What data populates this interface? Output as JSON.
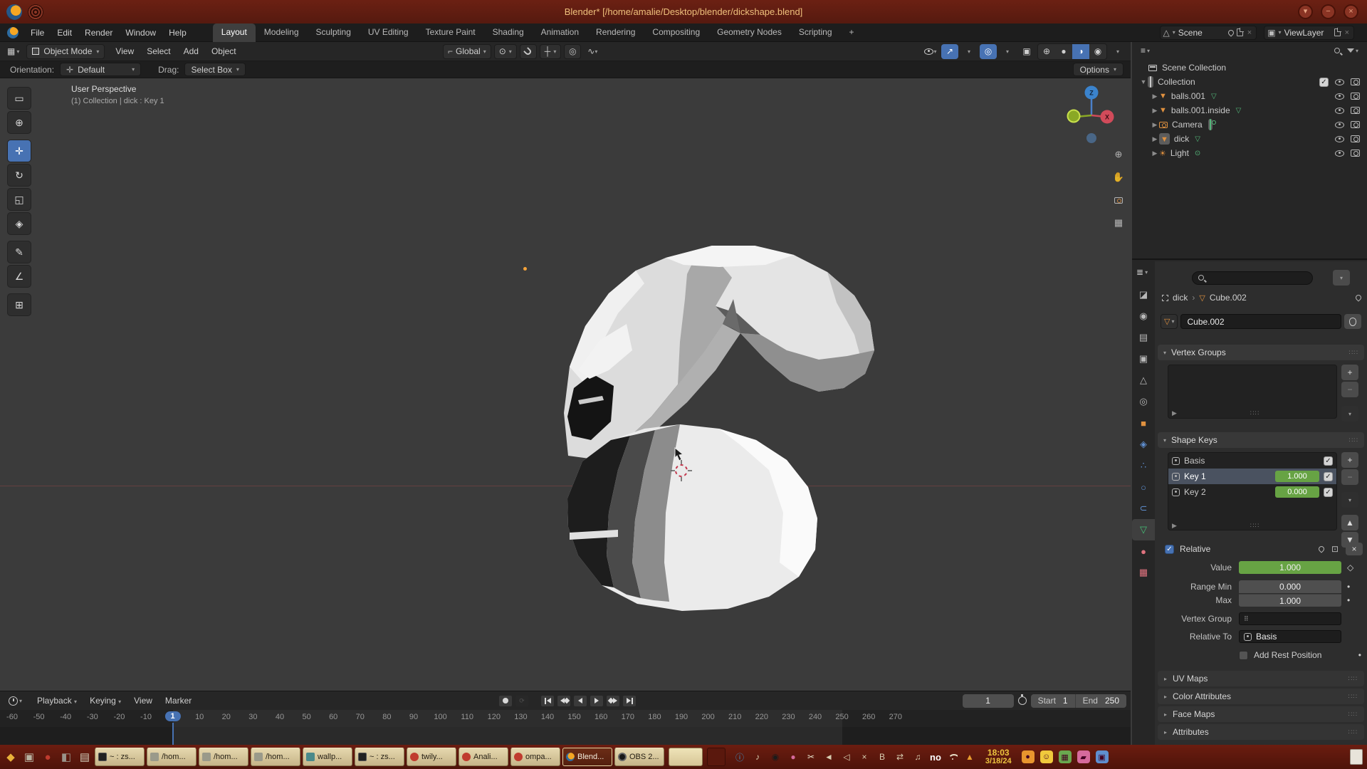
{
  "colors": {
    "accent_blue": "#4772b3",
    "value_green": "#67a344",
    "object_orange": "#e0913f",
    "data_green": "#53b87a",
    "titlebar_maroon": "#6b2013",
    "taskbar_tan": "#cfbf94"
  },
  "titlebar": {
    "title": "Blender* [/home/amalie/Desktop/blender/dickshape.blend]"
  },
  "menubar": {
    "menus": [
      "File",
      "Edit",
      "Render",
      "Window",
      "Help"
    ],
    "tabs": [
      {
        "label": "Layout",
        "active": true
      },
      {
        "label": "Modeling"
      },
      {
        "label": "Sculpting"
      },
      {
        "label": "UV Editing"
      },
      {
        "label": "Texture Paint"
      },
      {
        "label": "Shading"
      },
      {
        "label": "Animation"
      },
      {
        "label": "Rendering"
      },
      {
        "label": "Compositing"
      },
      {
        "label": "Geometry Nodes"
      },
      {
        "label": "Scripting"
      },
      {
        "label": "+"
      }
    ],
    "scene": {
      "value": "Scene"
    },
    "view_layer": {
      "value": "ViewLayer"
    }
  },
  "viewport_header": {
    "mode": "Object Mode",
    "menus": [
      "View",
      "Select",
      "Add",
      "Object"
    ],
    "orientation": "Global",
    "options": "Options"
  },
  "tool_settings": {
    "orientation_label": "Orientation:",
    "orientation_value": "Default",
    "drag_label": "Drag:",
    "drag_value": "Select Box"
  },
  "viewport": {
    "overlay_line1": "User Perspective",
    "overlay_line2": "(1) Collection | dick : Key 1",
    "gizmo": {
      "z": "Z",
      "x": "X"
    }
  },
  "outliner": {
    "root": "Scene Collection",
    "collection": {
      "name": "Collection"
    },
    "items": [
      {
        "name": "balls.001",
        "type": "mesh"
      },
      {
        "name": "balls.001.inside",
        "type": "mesh"
      },
      {
        "name": "Camera",
        "type": "camera",
        "data_boxed": true
      },
      {
        "name": "dick",
        "type": "mesh",
        "selected": true
      },
      {
        "name": "Light",
        "type": "light"
      }
    ]
  },
  "properties": {
    "tabs": [
      {
        "name": "tool-tab",
        "glyph": "◪",
        "color": "#b8b8b8"
      },
      {
        "name": "render-tab",
        "glyph": "◉",
        "color": "#b8b8b8"
      },
      {
        "name": "output-tab",
        "glyph": "▤",
        "color": "#b8b8b8"
      },
      {
        "name": "view-layer-tab",
        "glyph": "▣",
        "color": "#b8b8b8"
      },
      {
        "name": "scene-tab",
        "glyph": "△",
        "color": "#b8b8b8"
      },
      {
        "name": "world-tab",
        "glyph": "◎",
        "color": "#b8b8b8"
      },
      {
        "name": "object-tab",
        "glyph": "■",
        "color": "#e0913f"
      },
      {
        "name": "modifiers-tab",
        "glyph": "◈",
        "color": "#5f8fd0"
      },
      {
        "name": "particles-tab",
        "glyph": "∴",
        "color": "#5f8fd0"
      },
      {
        "name": "physics-tab",
        "glyph": "○",
        "color": "#5f8fd0"
      },
      {
        "name": "constraints-tab",
        "glyph": "⊂",
        "color": "#5f8fd0"
      },
      {
        "name": "object-data-tab",
        "glyph": "▽",
        "color": "#44c077",
        "active": true
      },
      {
        "name": "material-tab",
        "glyph": "●",
        "color": "#e0737f"
      },
      {
        "name": "texture-tab",
        "glyph": "▦",
        "color": "#e0737f"
      }
    ],
    "breadcrumb": {
      "object": "dick",
      "separator": "›",
      "data": "Cube.002"
    },
    "name_field": "Cube.002",
    "vertex_groups": {
      "title": "Vertex Groups"
    },
    "shape_keys": {
      "title": "Shape Keys",
      "rows": [
        {
          "name": "Basis",
          "value": ""
        },
        {
          "name": "Key 1",
          "value": "1.000",
          "selected": true
        },
        {
          "name": "Key 2",
          "value": "0.000"
        }
      ]
    },
    "relative": {
      "label": "Relative"
    },
    "fields": {
      "value_label": "Value",
      "value": "1.000",
      "range_min_label": "Range Min",
      "range_min": "0.000",
      "max_label": "Max",
      "max": "1.000",
      "vertex_group_label": "Vertex Group",
      "relative_to_label": "Relative To",
      "relative_to": "Basis",
      "add_rest_label": "Add Rest Position"
    },
    "sections": [
      "UV Maps",
      "Color Attributes",
      "Face Maps",
      "Attributes"
    ]
  },
  "timeline": {
    "menus": [
      {
        "label": "Playback",
        "chevron": true
      },
      {
        "label": "Keying",
        "chevron": true
      },
      {
        "label": "View"
      },
      {
        "label": "Marker"
      }
    ],
    "transport": [
      "jump-start",
      "prev-keyframe",
      "play-reverse",
      "play",
      "next-keyframe",
      "jump-end"
    ],
    "current_frame": "1",
    "start_label": "Start",
    "start_value": "1",
    "end_label": "End",
    "end_value": "250",
    "ticks": [
      "-60",
      "-50",
      "-40",
      "-30",
      "-20",
      "-10",
      "1",
      "10",
      "20",
      "30",
      "40",
      "50",
      "60",
      "70",
      "80",
      "90",
      "100",
      "110",
      "120",
      "130",
      "140",
      "150",
      "160",
      "170",
      "180",
      "190",
      "200",
      "210",
      "220",
      "230",
      "240",
      "250",
      "260",
      "270"
    ]
  },
  "taskbar": {
    "launchers": [
      {
        "name": "app-menu-icon",
        "glyph": "◆",
        "color": "#e8b13a"
      },
      {
        "name": "terminal-launcher-icon",
        "glyph": "▣",
        "color": "#b8b2a0"
      },
      {
        "name": "media-launcher-icon",
        "glyph": "●",
        "color": "#c03b2e"
      },
      {
        "name": "graphics-launcher-icon",
        "glyph": "◧",
        "color": "#9a948a"
      },
      {
        "name": "files-launcher-icon",
        "glyph": "▤",
        "color": "#cfc8b5"
      }
    ],
    "windows": [
      {
        "label": "~ : zs...",
        "icon": "terminal"
      },
      {
        "label": "/hom...",
        "icon": "folder"
      },
      {
        "label": "/hom...",
        "icon": "folder"
      },
      {
        "label": "/hom...",
        "icon": "folder"
      },
      {
        "label": "wallp...",
        "icon": "image"
      },
      {
        "label": "~ : zs...",
        "icon": "terminal"
      },
      {
        "label": "twily...",
        "icon": "browser"
      },
      {
        "label": "Anali...",
        "icon": "browser"
      },
      {
        "label": "ompa...",
        "icon": "browser"
      },
      {
        "label": "Blend...",
        "icon": "blender",
        "active": true
      },
      {
        "label": "OBS 2...",
        "icon": "obs"
      }
    ],
    "tray": [
      {
        "name": "info-tray-icon",
        "glyph": "ⓘ",
        "color": "#3d9bd6"
      },
      {
        "name": "headphones-tray-icon",
        "glyph": "♪",
        "color": "#d8cdb0"
      },
      {
        "name": "recorder-tray-icon",
        "glyph": "◉",
        "color": "#1b1b1b"
      },
      {
        "name": "color-picker-tray-icon",
        "glyph": "●",
        "color": "#d66a9c"
      },
      {
        "name": "scissors-tray-icon",
        "glyph": "✂",
        "color": "#e8e0c8"
      },
      {
        "name": "volume-tray-icon",
        "glyph": "◄",
        "color": "#d8cdb0"
      },
      {
        "name": "back-tray-icon",
        "glyph": "◁",
        "color": "#d8cdb0"
      },
      {
        "name": "close-tray-icon",
        "glyph": "×",
        "color": "#d8cdb0"
      },
      {
        "name": "bluetooth-tray-icon",
        "glyph": "B",
        "color": "#d8cdb0"
      },
      {
        "name": "usb-tray-icon",
        "glyph": "⇄",
        "color": "#d8cdb0"
      },
      {
        "name": "music-tray-icon",
        "glyph": "♫",
        "color": "#d8cdb0"
      },
      {
        "name": "mic-status-label",
        "glyph": "no",
        "text": true,
        "color": "#ffffff"
      },
      {
        "name": "wifi-tray-icon",
        "wifi": true
      },
      {
        "name": "warning-tray-icon",
        "glyph": "▲",
        "color": "#e89b2e"
      }
    ],
    "clock": {
      "time": "18:03",
      "date": "3/18/24"
    },
    "tray_right": [
      {
        "name": "notification-bell-icon",
        "glyph": "●",
        "bg": "#e8952e"
      },
      {
        "name": "emoji-tray-icon",
        "glyph": "☺",
        "bg": "#f0c93c"
      },
      {
        "name": "calculator-tray-icon",
        "glyph": "▦",
        "bg": "#6aa84f"
      },
      {
        "name": "paint-tray-icon",
        "glyph": "▰",
        "bg": "#d66a9c"
      },
      {
        "name": "package-tray-icon",
        "glyph": "▣",
        "bg": "#5f8fd0"
      }
    ]
  }
}
